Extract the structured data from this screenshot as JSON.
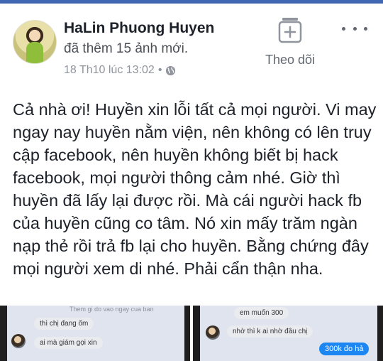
{
  "post": {
    "author": "HaLin Phuong Huyen",
    "action": "đã thêm 15 ảnh mới.",
    "timestamp": "18 Th10 lúc 13:02",
    "separator": "•",
    "privacy_icon": "globe-icon",
    "follow_label": "Theo dõi",
    "follow_icon": "add-frame-icon",
    "more_icon": "more-dots-icon",
    "text": "Cả nhà ơi! Huyền xin lỗi tất cả mọi người. Vi may ngay nay huyền  nằm viện, nên không có lên truy cập facebook, nên huyền không biết bị hack facebook, mọi người thông cảm nhé. Giờ thì huyền đã lấy lại được rồi. Mà cái người hack fb của huyền cũng co tâm. Nó xin mấy trăm ngàn nạp thẻ rồi trả fb lại cho huyền. Bằng chứng đây mọi người xem di nhé. Phải cẩn thận nha."
  },
  "photos": [
    {
      "header_faint": "Them gi do vao ngay cua ban",
      "messages": [
        "thì chị đang ốm",
        "ai mà giám gọi xin"
      ]
    },
    {
      "messages": [
        "em muốn 300",
        "nhờ thì k ai nhờ đâu chị",
        "300k đo hả"
      ]
    }
  ],
  "colors": {
    "brand_blue": "#4267b2",
    "messenger_blue": "#1c86f2",
    "meta_gray": "#90949c"
  }
}
